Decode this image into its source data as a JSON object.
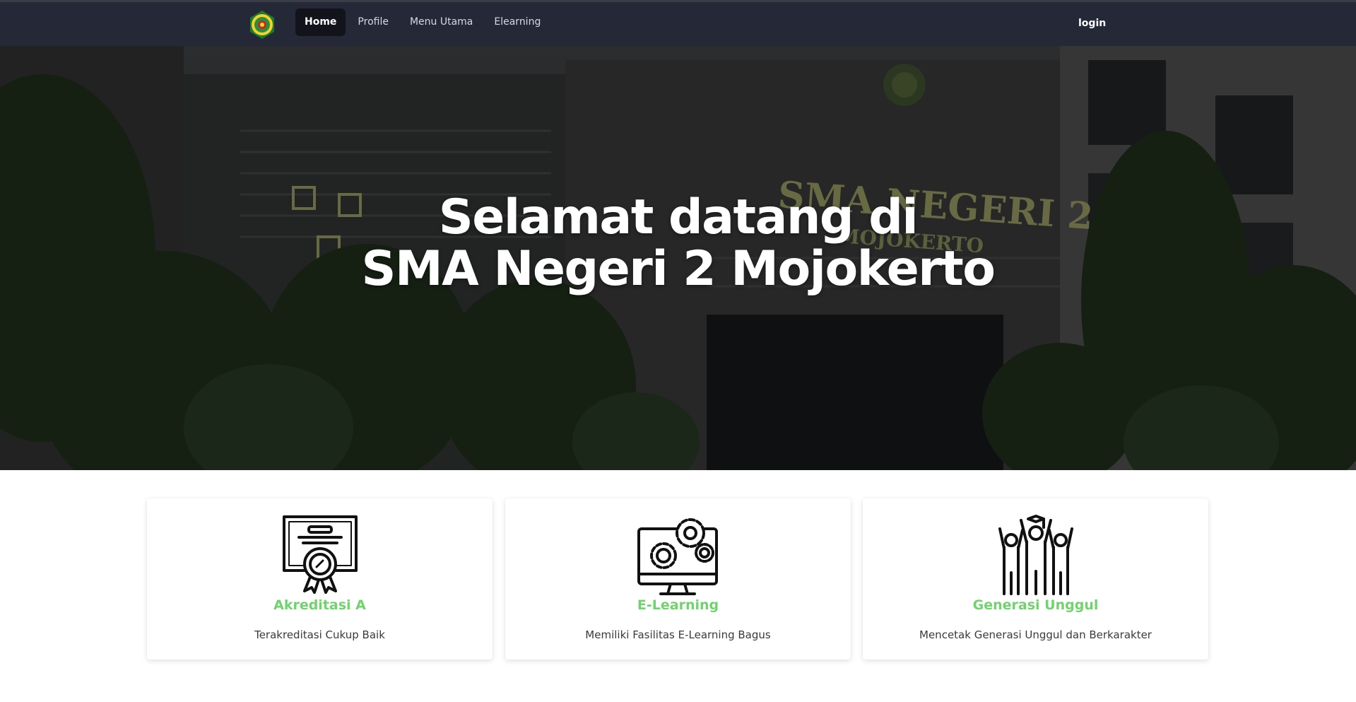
{
  "nav": {
    "items": [
      {
        "label": "Home",
        "active": true
      },
      {
        "label": "Profile",
        "active": false
      },
      {
        "label": "Menu Utama",
        "active": false
      },
      {
        "label": "Elearning",
        "active": false
      }
    ],
    "login_label": "login",
    "logo_icon": "school-crest-icon"
  },
  "hero": {
    "line1": "Selamat datang di",
    "line2": "SMA Negeri 2 Mojokerto",
    "building_sign_line1": "SMA NEGERI 2",
    "building_sign_line2": "MOJOKERTO"
  },
  "features": [
    {
      "icon": "certificate-award-icon",
      "title": "Akreditasi A",
      "description": "Terakreditasi Cukup Baik"
    },
    {
      "icon": "computer-gears-icon",
      "title": "E-Learning",
      "description": "Memiliki Fasilitas E-Learning Bagus"
    },
    {
      "icon": "students-celebrating-icon",
      "title": "Generasi Unggul",
      "description": "Mencetak Generasi Unggul dan Berkarakter"
    }
  ],
  "colors": {
    "navbar": "#252836",
    "accent_green": "#6fd46b",
    "text_dark": "#3a3a3a"
  }
}
